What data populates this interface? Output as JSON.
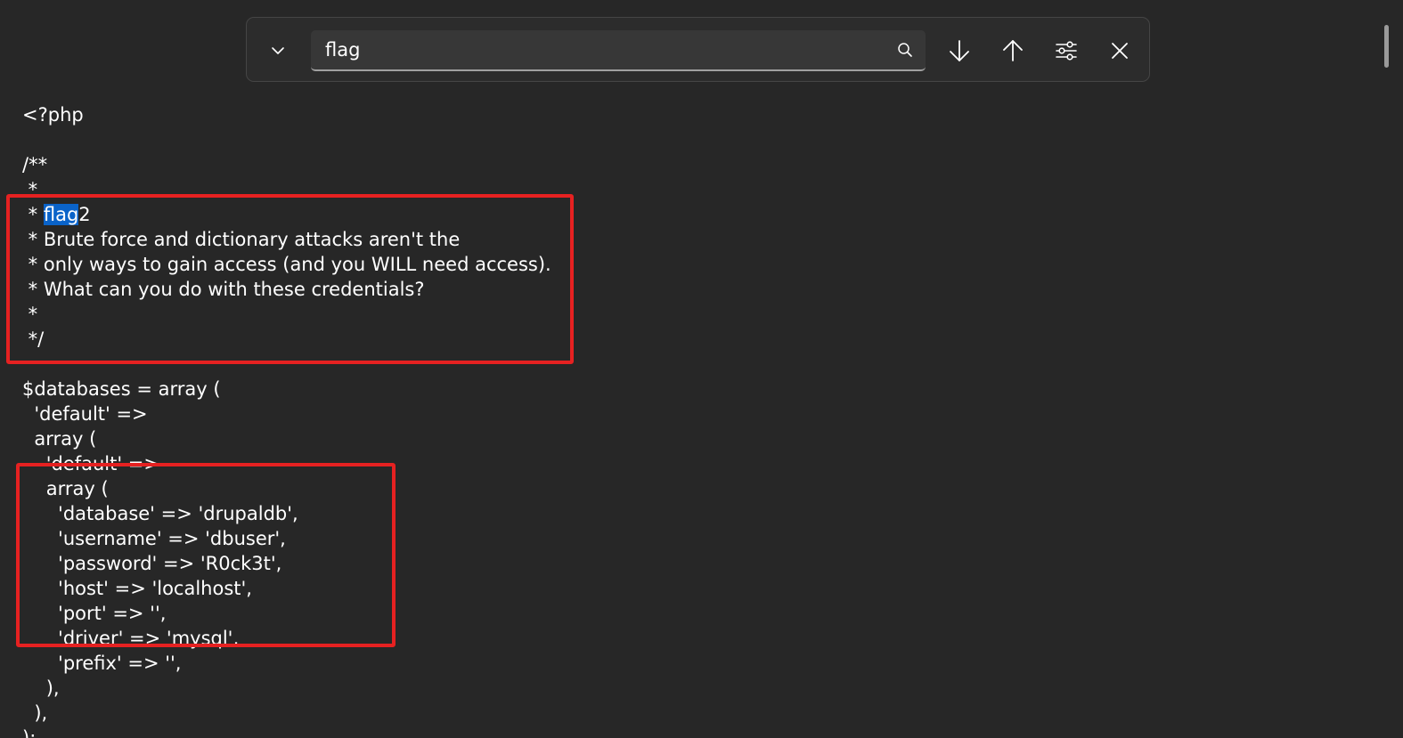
{
  "find_bar": {
    "query": "flag",
    "icons": {
      "toggle": "chevron-down-icon",
      "search": "search-icon",
      "next": "arrow-down-icon",
      "previous": "arrow-up-icon",
      "options": "sliders-icon",
      "close": "close-icon"
    }
  },
  "editor": {
    "lines": [
      "<?php",
      "",
      "/**",
      " *",
      " * ",
      " * Brute force and dictionary attacks aren't the",
      " * only ways to gain access (and you WILL need access).",
      " * What can you do with these credentials?",
      " *",
      " */",
      "",
      "$databases = array (",
      "  'default' =>",
      "  array (",
      "    'default' =>",
      "    array (",
      "      'database' => 'drupaldb',",
      "      'username' => 'dbuser',",
      "      'password' => 'R0ck3t',",
      "      'host' => 'localhost',",
      "      'port' => '',",
      "      'driver' => 'mysql',",
      "      'prefix' => '',",
      "    ),",
      "  ),",
      ");"
    ],
    "match_text": "flag",
    "match_suffix": "2"
  },
  "colors": {
    "background": "#272727",
    "match_highlight": "#0a63c9",
    "annotation_box": "#e62121"
  }
}
